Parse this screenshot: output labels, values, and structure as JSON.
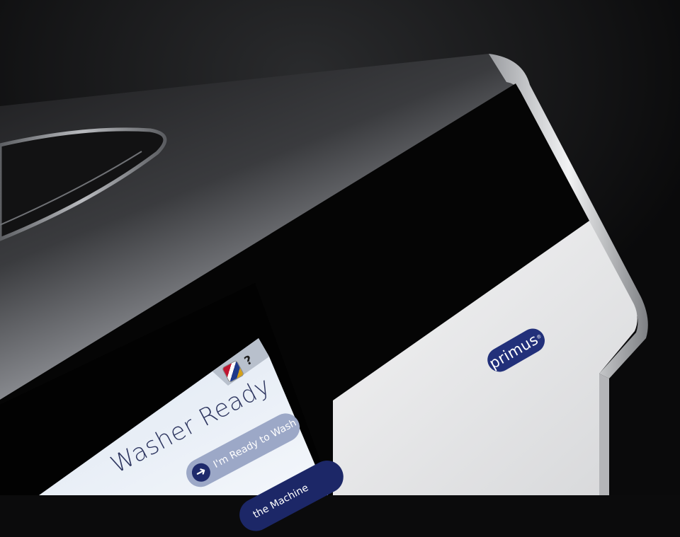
{
  "screen": {
    "title": "Washer Ready",
    "buttons": {
      "ready": "I'm Ready to Wash",
      "machine": "the Machine"
    },
    "help_label": "?",
    "language_icon": "flag-icon"
  },
  "brand": {
    "name": "primus",
    "mark": "®",
    "color": "#22307a"
  },
  "colors": {
    "background": "#0b0b0c",
    "panel": "#050505",
    "door": "#ededee",
    "button_light": "#9ca8c7",
    "button_dark": "#1c2767"
  }
}
